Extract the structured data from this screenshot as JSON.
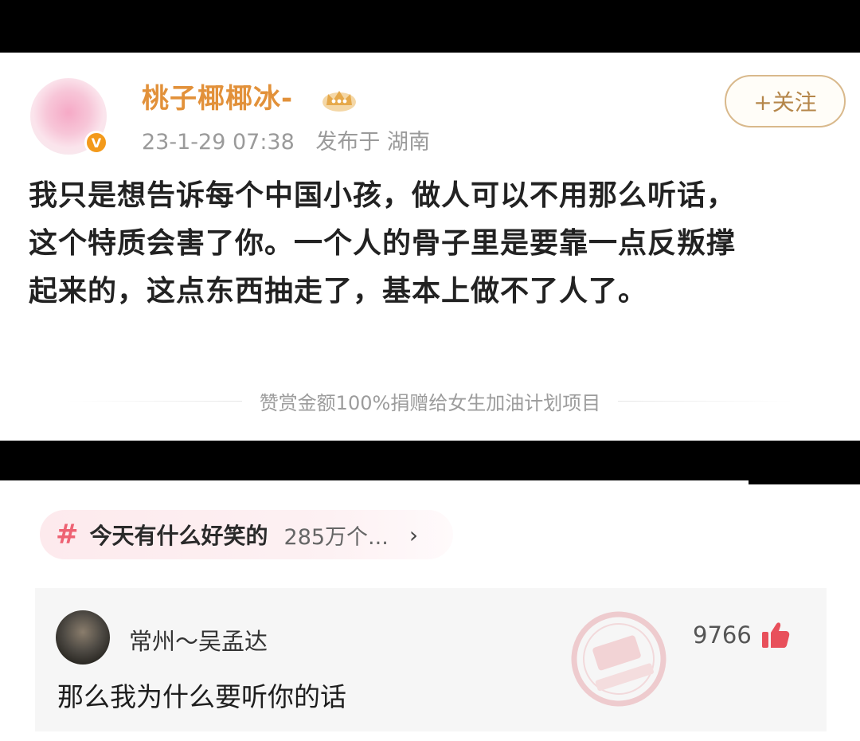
{
  "post": {
    "username": "桃子椰椰冰-",
    "timestamp": "23-1-29 07:38",
    "location_label": "发布于 湖南",
    "follow_label": "+关注",
    "body_lines": [
      "我只是想告诉每个中国小孩，做人可以不用那么听话，",
      "这个特质会害了你。一个人的骨子里是要靠一点反叛撑",
      "起来的，这点东西抽走了，基本上做不了人了。"
    ],
    "reward_note": "赞赏金额100%捐赠给女生加油计划项目",
    "verified_badge": "V"
  },
  "topic": {
    "hash": "#",
    "title": "今天有什么好笑的",
    "count": "285万个...",
    "chevron": "›"
  },
  "comment": {
    "author": "常州～吴孟达",
    "text": "那么我为什么要听你的话",
    "likes": "9766"
  },
  "colors": {
    "username": "#e2913a",
    "hash": "#ee6273",
    "like_icon": "#e8505b",
    "verified": "#f39a1b"
  },
  "icons": {
    "verified": "verified-badge-icon",
    "crown": "crown-icon",
    "like": "thumbs-up-icon",
    "chevron": "chevron-right-icon"
  }
}
